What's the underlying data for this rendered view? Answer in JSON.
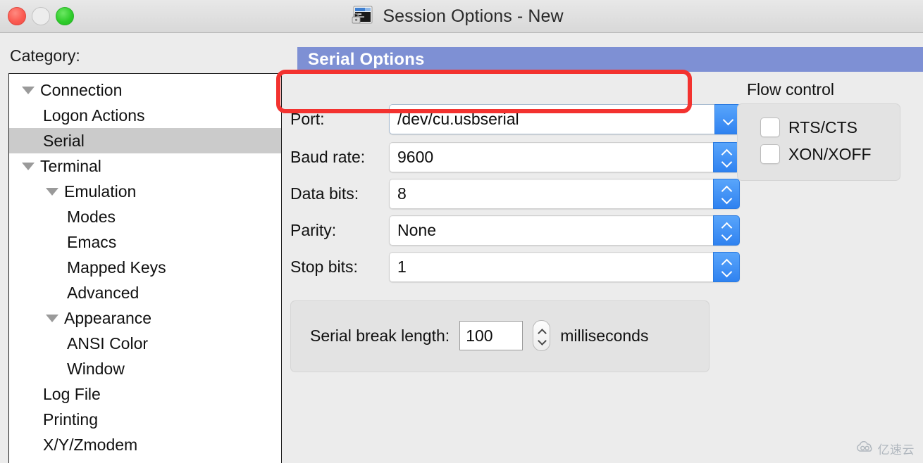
{
  "window": {
    "title": "Session Options - New",
    "icon": "secure-terminal-icon",
    "controls": {
      "close": "close",
      "minimize": "minimize",
      "maximize": "maximize"
    }
  },
  "sidebar": {
    "label": "Category:",
    "items": [
      {
        "label": "Connection",
        "depth": 0,
        "twisty": "down",
        "selected": false
      },
      {
        "label": "Logon Actions",
        "depth": 1,
        "twisty": "none",
        "selected": false
      },
      {
        "label": "Serial",
        "depth": 1,
        "twisty": "none",
        "selected": true
      },
      {
        "label": "Terminal",
        "depth": 0,
        "twisty": "down",
        "selected": false
      },
      {
        "label": "Emulation",
        "depth": 1,
        "twisty": "down",
        "selected": false
      },
      {
        "label": "Modes",
        "depth": 2,
        "twisty": "none",
        "selected": false
      },
      {
        "label": "Emacs",
        "depth": 2,
        "twisty": "none",
        "selected": false
      },
      {
        "label": "Mapped Keys",
        "depth": 2,
        "twisty": "none",
        "selected": false
      },
      {
        "label": "Advanced",
        "depth": 2,
        "twisty": "none",
        "selected": false
      },
      {
        "label": "Appearance",
        "depth": 1,
        "twisty": "down",
        "selected": false
      },
      {
        "label": "ANSI Color",
        "depth": 2,
        "twisty": "none",
        "selected": false
      },
      {
        "label": "Window",
        "depth": 2,
        "twisty": "none",
        "selected": false
      },
      {
        "label": "Log File",
        "depth": 1,
        "twisty": "none",
        "selected": false
      },
      {
        "label": "Printing",
        "depth": 1,
        "twisty": "none",
        "selected": false
      },
      {
        "label": "X/Y/Zmodem",
        "depth": 1,
        "twisty": "none",
        "selected": false
      }
    ]
  },
  "main": {
    "section_title": "Serial Options",
    "fields": {
      "port": {
        "label": "Port:",
        "value": "/dev/cu.usbserial",
        "control": "combobox"
      },
      "baud_rate": {
        "label": "Baud rate:",
        "value": "9600",
        "control": "stepper"
      },
      "data_bits": {
        "label": "Data bits:",
        "value": "8",
        "control": "stepper"
      },
      "parity": {
        "label": "Parity:",
        "value": "None",
        "control": "stepper"
      },
      "stop_bits": {
        "label": "Stop bits:",
        "value": "1",
        "control": "stepper"
      }
    },
    "flow_control": {
      "label": "Flow control",
      "checkboxes": [
        {
          "label": "RTS/CTS",
          "checked": false
        },
        {
          "label": "XON/XOFF",
          "checked": false
        }
      ]
    },
    "serial_break": {
      "label": "Serial break length:",
      "value": "100",
      "units": "milliseconds"
    }
  },
  "annotation": {
    "highlight_target": "port-field",
    "highlight_color": "#f3322f"
  },
  "watermark": {
    "text": "亿速云",
    "icon": "cloud-icon"
  },
  "colors": {
    "section_header_bg": "#7e90d4",
    "accent_blue": "#2f82f0",
    "selection_gray": "#cbcbcb",
    "window_bg": "#ececec"
  }
}
